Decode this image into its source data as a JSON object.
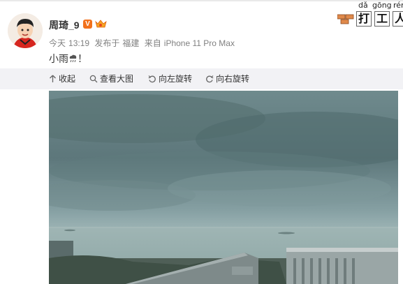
{
  "post": {
    "username": "周琦_9",
    "verified_mark": "V",
    "meta": {
      "day": "今天",
      "time": "13:19",
      "location_prefix": "发布于",
      "location": "福建",
      "source_prefix": "来自",
      "device": "iPhone 11 Pro Max"
    },
    "text": "小雨",
    "text_suffix": "！",
    "icons": {
      "avatar": "cartoon-avatar",
      "verified": "orange-verified-badge",
      "vip": "vip-crown-badge",
      "emoji": "rain-cloud-emoji"
    }
  },
  "sticker": {
    "pinyin": [
      "dǎ",
      "gōng",
      "rén"
    ],
    "chars": [
      "打",
      "工",
      "人"
    ]
  },
  "toolbar": {
    "collapse": "收起",
    "view_large": "查看大图",
    "rotate_left": "向左旋转",
    "rotate_right": "向右旋转"
  },
  "colors": {
    "toolbar_bg": "#f2f2f5",
    "meta_text": "#808080",
    "badge_orange": "#f2711c"
  }
}
